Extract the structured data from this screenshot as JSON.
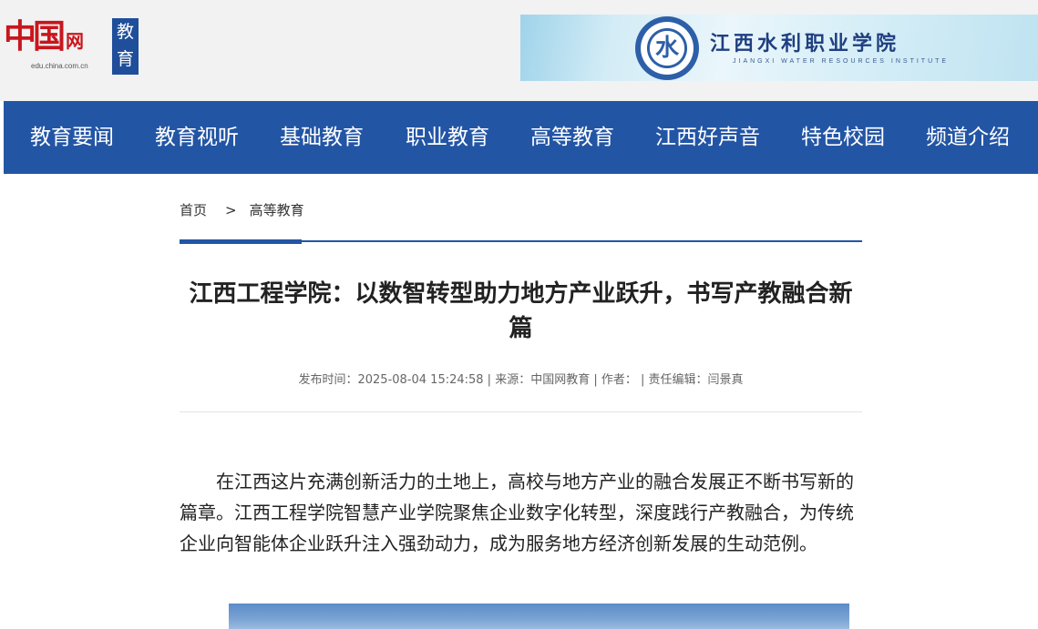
{
  "header": {
    "logo": {
      "mark": "中国",
      "wang": "网",
      "url": "edu.china.com.cn",
      "channel": "教育"
    },
    "banner": {
      "emblem_glyph": "水",
      "title": "江西水利职业学院",
      "subtitle": "JIANGXI WATER RESOURCES INSTITUTE"
    }
  },
  "nav": {
    "items": [
      {
        "label": "教育要闻"
      },
      {
        "label": "教育视听"
      },
      {
        "label": "基础教育"
      },
      {
        "label": "职业教育"
      },
      {
        "label": "高等教育"
      },
      {
        "label": "江西好声音"
      },
      {
        "label": "特色校园"
      },
      {
        "label": "频道介绍"
      }
    ]
  },
  "breadcrumb": {
    "home": "首页",
    "separator": ">",
    "current": "高等教育"
  },
  "article": {
    "title": "江西工程学院：以数智转型助力地方产业跃升，书写产教融合新篇",
    "meta": "发布时间：2025-08-04 15:24:58 | 来源：中国网教育 | 作者：  | 责任编辑：闫景真",
    "body": "在江西这片充满创新活力的土地上，高校与地方产业的融合发展正不断书写新的篇章。江西工程学院智慧产业学院聚焦企业数字化转型，深度践行产教融合，为传统企业向智能体企业跃升注入强劲动力，成为服务地方经济创新发展的生动范例。"
  },
  "colors": {
    "nav_bg": "#2355a5",
    "header_bg": "#f2f2f2",
    "logo_red": "#c8161d"
  }
}
